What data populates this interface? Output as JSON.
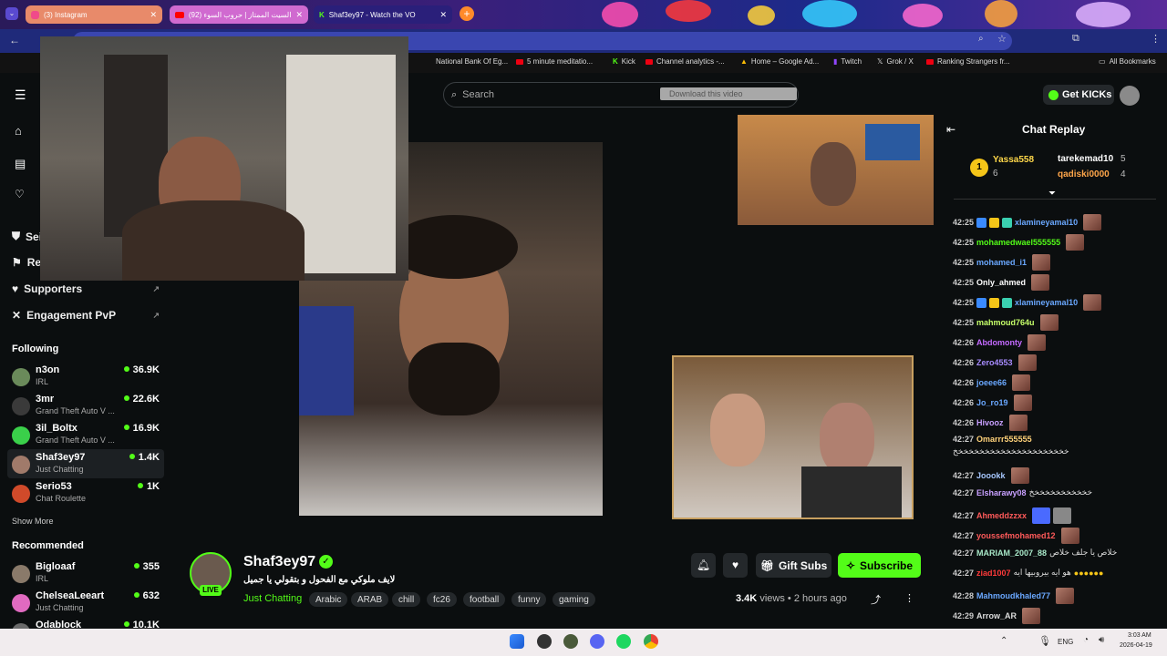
{
  "browser": {
    "tabs": [
      {
        "label": "(3) Instagram"
      },
      {
        "label": "(92) السيت الممتاز | حروب السوء"
      },
      {
        "label": "Shaf3ey97 - Watch the VO"
      }
    ],
    "bookmarks": [
      "National Bank Of Eg...",
      "5 minute meditatio...",
      "Kick",
      "Channel analytics -...",
      "Home – Google Ad...",
      "Twitch",
      "Grok / X",
      "Ranking Strangers fr..."
    ],
    "all_bookmarks": "All Bookmarks"
  },
  "header": {
    "search_placeholder": "Search",
    "download_label": "Download this video",
    "get_kicks_label": "Get KICKs"
  },
  "sidebar": {
    "partial_items": [
      "Sei",
      "Rep"
    ],
    "supporters": "Supporters",
    "engagement": "Engagement PvP",
    "following_title": "Following",
    "following": [
      {
        "name": "n3on",
        "category": "IRL",
        "viewers": "36.9K"
      },
      {
        "name": "3mr",
        "category": "Grand Theft Auto V ...",
        "viewers": "22.6K"
      },
      {
        "name": "3il_Boltx",
        "category": "Grand Theft Auto V ...",
        "viewers": "16.9K"
      },
      {
        "name": "Shaf3ey97",
        "category": "Just Chatting",
        "viewers": "1.4K"
      },
      {
        "name": "Serio53",
        "category": "Chat Roulette",
        "viewers": "1K"
      }
    ],
    "show_more": "Show More",
    "recommended_title": "Recommended",
    "recommended": [
      {
        "name": "Bigloaaf",
        "category": "IRL",
        "viewers": "355"
      },
      {
        "name": "ChelseaLeeart",
        "category": "Just Chatting",
        "viewers": "632"
      },
      {
        "name": "Odablock",
        "category": "",
        "viewers": "10.1K"
      }
    ]
  },
  "stream": {
    "channel_name": "Shaf3ey97",
    "title": "لايف ملوكي مع الفحول و بتقولي يا جميل",
    "live_label": "LIVE",
    "category": "Just Chatting",
    "tags": [
      "Arabic",
      "ARAB",
      "chill",
      "fc26",
      "football",
      "funny",
      "gaming"
    ],
    "views": "3.4K",
    "views_label": "views",
    "time_ago": "2 hours ago",
    "gift_subs_label": "Gift Subs",
    "subscribe_label": "Subscribe"
  },
  "chat": {
    "title": "Chat Replay",
    "top_gifters": [
      {
        "rank": "1",
        "name": "Yassa558",
        "count": "6"
      },
      {
        "name": "tarekemad10",
        "count": "5"
      },
      {
        "name": "qadiski0000",
        "count": "4"
      }
    ],
    "messages": [
      {
        "time": "42:25",
        "user": "xlamineyamal10",
        "color": "#6aa8ff",
        "text": ""
      },
      {
        "time": "42:25",
        "user": "mohamedwael555555",
        "color": "#53fc18",
        "text": ""
      },
      {
        "time": "42:25",
        "user": "mohamed_i1",
        "color": "#6aa8ff",
        "text": ""
      },
      {
        "time": "42:25",
        "user": "Only_ahmed",
        "color": "#ffffff",
        "text": ""
      },
      {
        "time": "42:25",
        "user": "xlamineyamal10",
        "color": "#6aa8ff",
        "text": ""
      },
      {
        "time": "42:25",
        "user": "mahmoud764u",
        "color": "#c6ff6a",
        "text": ""
      },
      {
        "time": "42:26",
        "user": "Abdomonty",
        "color": "#c46aff",
        "text": ""
      },
      {
        "time": "42:26",
        "user": "Zero4553",
        "color": "#a78bff",
        "text": ""
      },
      {
        "time": "42:26",
        "user": "joeee66",
        "color": "#6aa8ff",
        "text": ""
      },
      {
        "time": "42:26",
        "user": "Jo_ro19",
        "color": "#6aa8ff",
        "text": ""
      },
      {
        "time": "42:26",
        "user": "Hivooz",
        "color": "#c8a0ff",
        "text": ""
      },
      {
        "time": "42:27",
        "user": "Omarrr555555",
        "color": "#ffd27a",
        "text": "خخخخخخخخخخخخخخخخخخخخخخ"
      },
      {
        "time": "42:27",
        "user": "Joookk",
        "color": "#a8c8ff",
        "text": ""
      },
      {
        "time": "42:27",
        "user": "Elsharawy08",
        "color": "#c8a0ff",
        "text": "خخخخخخخخخخخخ"
      },
      {
        "time": "42:27",
        "user": "Ahmeddzzxx",
        "color": "#ff5a5a",
        "text": ""
      },
      {
        "time": "42:27",
        "user": "youssefmohamed12",
        "color": "#ff5a5a",
        "text": ""
      },
      {
        "time": "42:27",
        "user": "MARIAM_2007_88",
        "color": "#a8e8c8",
        "text": "خلاص يا جلف خلاص"
      },
      {
        "time": "42:27",
        "user": "ziad1007",
        "color": "#ff3a3a",
        "text": "هو ايه بيروبيها ايه"
      },
      {
        "time": "42:28",
        "user": "Mahmoudkhaled77",
        "color": "#6aa8ff",
        "text": ""
      },
      {
        "time": "42:29",
        "user": "Arrow_AR",
        "color": "#dddddd",
        "text": ""
      }
    ]
  },
  "taskbar": {
    "lang": "ENG",
    "time": "3:03 AM",
    "date": "2026-04-19"
  },
  "colors": {
    "kick_green": "#53fc18",
    "background": "#0b0e0f"
  }
}
